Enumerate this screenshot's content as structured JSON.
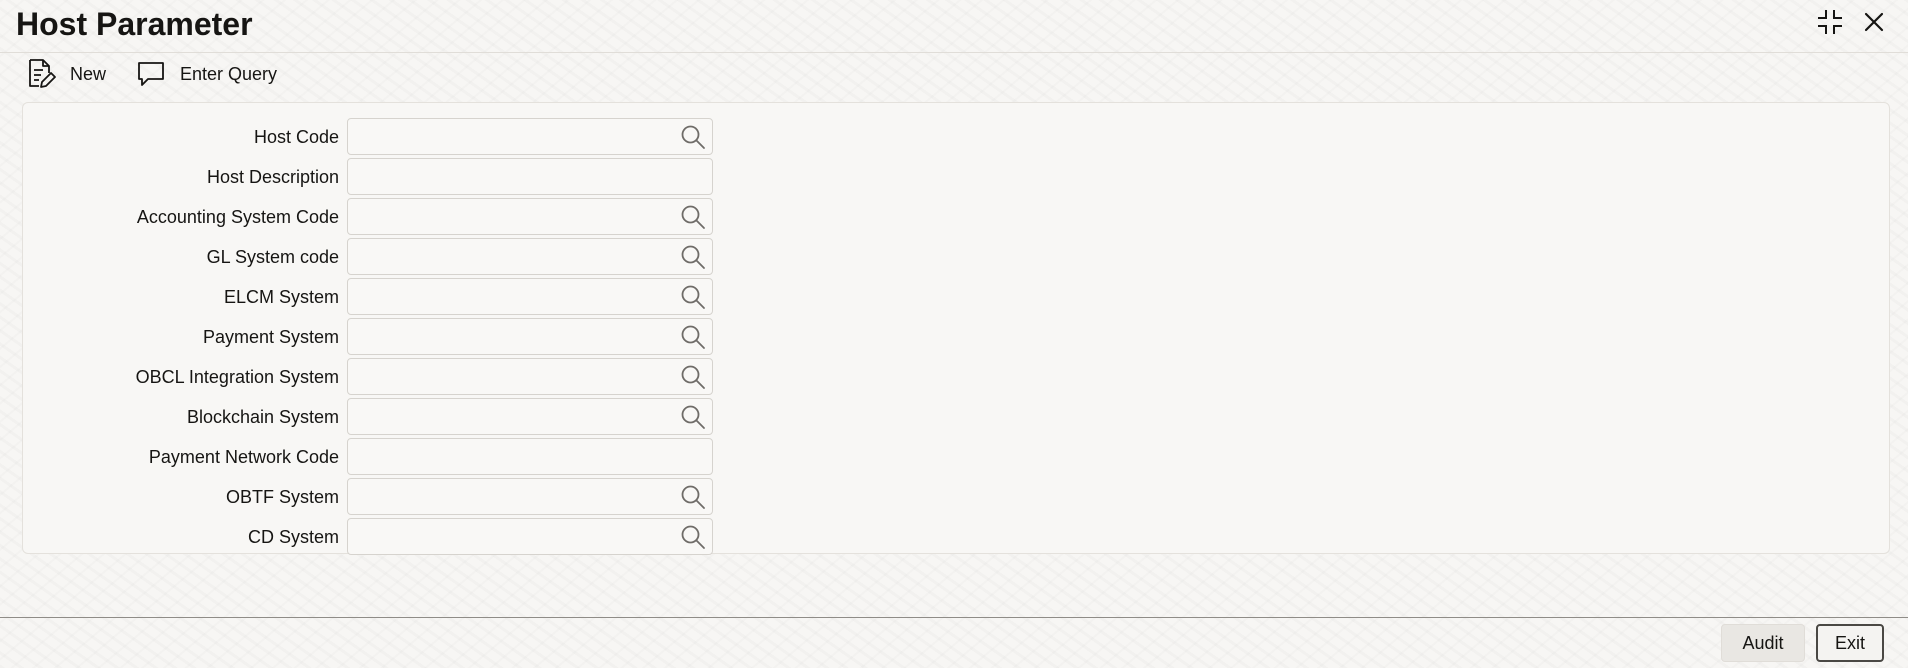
{
  "window": {
    "title": "Host Parameter",
    "controls": [
      {
        "name": "restore-icon",
        "label": "Restore"
      },
      {
        "name": "close-icon",
        "label": "Close"
      }
    ]
  },
  "toolbar": {
    "new_label": "New",
    "new_icon": "document-edit-icon",
    "enter_query_label": "Enter Query",
    "enter_query_icon": "speech-bubble-icon"
  },
  "form": {
    "fields": [
      {
        "id": "host-code",
        "label": "Host Code",
        "value": "",
        "has_lov": true
      },
      {
        "id": "host-description",
        "label": "Host Description",
        "value": "",
        "has_lov": false
      },
      {
        "id": "accounting-system-code",
        "label": "Accounting System Code",
        "value": "",
        "has_lov": true
      },
      {
        "id": "gl-system-code",
        "label": "GL System code",
        "value": "",
        "has_lov": true
      },
      {
        "id": "elcm-system",
        "label": "ELCM System",
        "value": "",
        "has_lov": true
      },
      {
        "id": "payment-system",
        "label": "Payment System",
        "value": "",
        "has_lov": true
      },
      {
        "id": "obcl-integration-system",
        "label": "OBCL Integration System",
        "value": "",
        "has_lov": true
      },
      {
        "id": "blockchain-system",
        "label": "Blockchain System",
        "value": "",
        "has_lov": true
      },
      {
        "id": "payment-network-code",
        "label": "Payment Network Code",
        "value": "",
        "has_lov": false
      },
      {
        "id": "obtf-system",
        "label": "OBTF System",
        "value": "",
        "has_lov": true
      },
      {
        "id": "cd-system",
        "label": "CD System",
        "value": "",
        "has_lov": true
      }
    ]
  },
  "footer": {
    "audit_label": "Audit",
    "exit_label": "Exit"
  },
  "colors": {
    "text": "#161513",
    "background": "#f7f6f4",
    "panel": "#f8f7f5",
    "border": "#d6d3ce",
    "icon": "#6f6c68"
  }
}
